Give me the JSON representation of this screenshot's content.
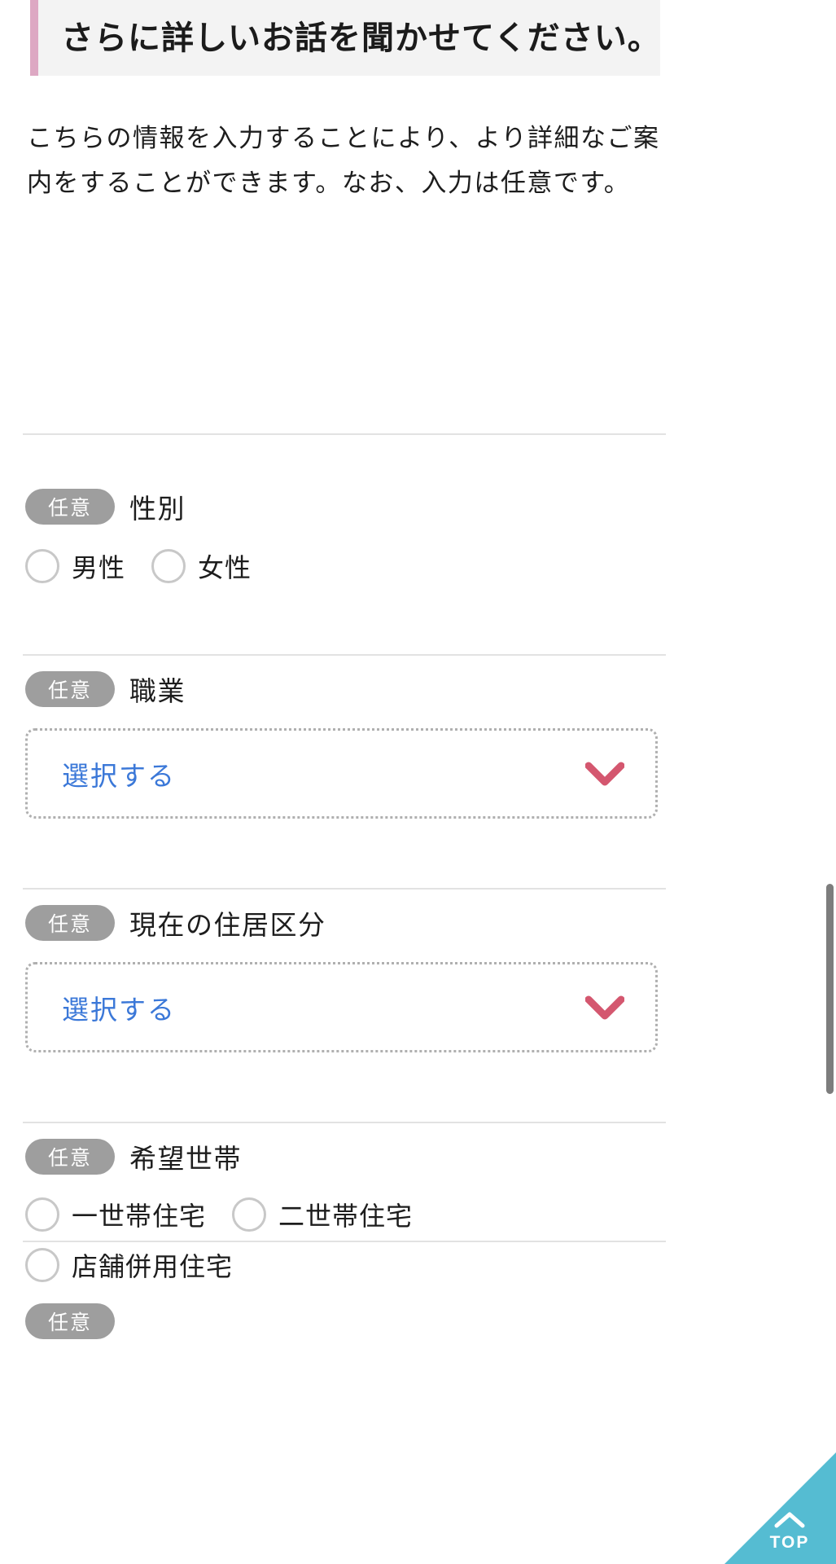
{
  "heading": {
    "title": "さらに詳しいお話を聞かせてください。",
    "accent_color": "#dda8c3",
    "background_color": "#f3f3f3"
  },
  "lead": {
    "text": "こちらの情報を入力することにより、より詳細なご案内をすることができます。なお、入力は任意です。"
  },
  "badges": {
    "optional_label": "任意",
    "color": "#9e9e9e"
  },
  "fields": [
    {
      "id": "gender",
      "badge": "任意",
      "label": "性別",
      "type": "radio",
      "options": [
        {
          "label": "男性",
          "selected": false
        },
        {
          "label": "女性",
          "selected": false
        }
      ]
    },
    {
      "id": "occupation",
      "badge": "任意",
      "label": "職業",
      "type": "select",
      "value": "選択する",
      "placeholder": "選択する"
    },
    {
      "id": "residence-type",
      "badge": "任意",
      "label": "現在の住居区分",
      "type": "select",
      "value": "選択する",
      "placeholder": "選択する"
    },
    {
      "id": "household",
      "badge": "任意",
      "label": "希望世帯",
      "type": "radio",
      "options": [
        {
          "label": "一世帯住宅",
          "selected": false
        },
        {
          "label": "二世帯住宅",
          "selected": false
        },
        {
          "label": "店舗併用住宅",
          "selected": false
        }
      ]
    }
  ],
  "page_top": {
    "label": "TOP",
    "icon": "chevron-up-icon",
    "color": "#55bcd2"
  },
  "scrollbar": {
    "color": "#7d7d7d"
  },
  "colors": {
    "select_text": "#3b78d8",
    "chevron": "#d4576f",
    "divider": "#e2e2e2",
    "radio_border": "#c8c8c8"
  }
}
